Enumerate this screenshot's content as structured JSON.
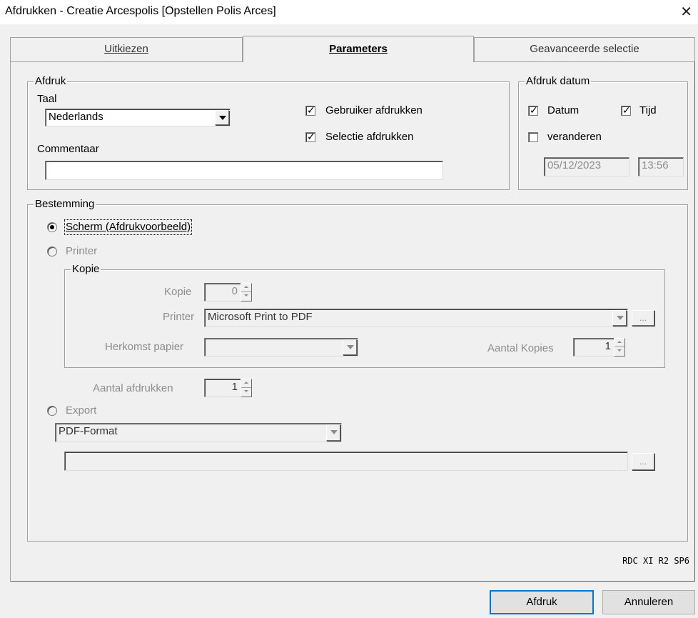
{
  "window": {
    "title": "Afdrukken - Creatie Arcespolis [Opstellen Polis Arces]",
    "close_symbol": "✕"
  },
  "tabs": [
    {
      "label": "Uitkiezen",
      "active": false
    },
    {
      "label": "Parameters",
      "active": true
    },
    {
      "label": "Geavanceerde selectie",
      "active": false
    }
  ],
  "afdruk": {
    "legend": "Afdruk",
    "taal_label": "Taal",
    "taal_value": "Nederlands",
    "gebruiker_label": "Gebruiker afdrukken",
    "gebruiker_checked": true,
    "selectie_label": "Selectie afdrukken",
    "selectie_checked": true,
    "commentaar_label": "Commentaar",
    "commentaar_value": ""
  },
  "afdruk_datum": {
    "legend": "Afdruk datum",
    "datum_label": "Datum",
    "datum_checked": true,
    "tijd_label": "Tijd",
    "tijd_checked": true,
    "veranderen_label": "veranderen",
    "veranderen_checked": false,
    "date_value": "05/12/2023",
    "time_value": "13:56"
  },
  "bestemming": {
    "legend": "Bestemming",
    "scherm_label": "Scherm (Afdrukvoorbeeld)",
    "printer_label": "Printer",
    "export_label": "Export",
    "selected": "scherm",
    "kopie_group": {
      "legend": "Kopie",
      "kopie_label": "Kopie",
      "kopie_value": "0",
      "printer_label": "Printer",
      "printer_value": "Microsoft Print to PDF",
      "herkomst_label": "Herkomst papier",
      "herkomst_value": "",
      "aantal_kopies_label": "Aantal Kopies",
      "aantal_kopies_value": "1",
      "browse_label": "..."
    },
    "aantal_afdrukken_label": "Aantal afdrukken",
    "aantal_afdrukken_value": "1",
    "export_format": "PDF-Format",
    "export_path": "",
    "export_browse_label": "..."
  },
  "version_text": "RDC XI R2 SP6",
  "buttons": {
    "print": "Afdruk",
    "cancel": "Annuleren"
  }
}
